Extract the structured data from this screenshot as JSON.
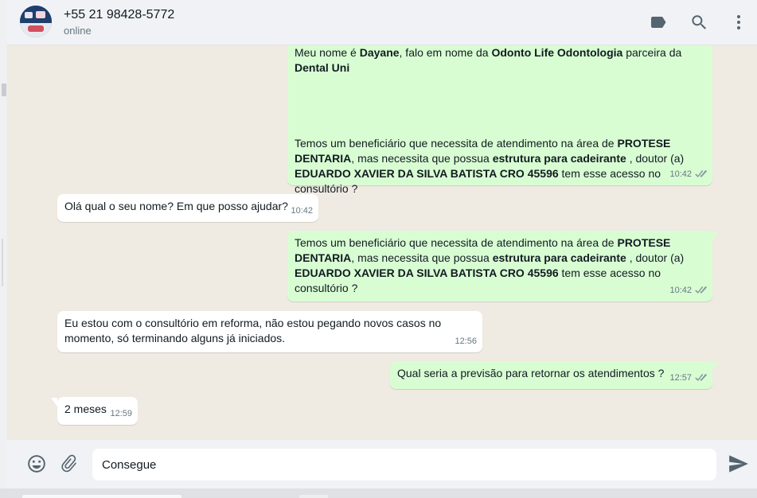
{
  "header": {
    "contact_name": "+55 21 98428-5772",
    "contact_status": "online",
    "icons": [
      "label-icon",
      "search-icon",
      "menu-dots-icon"
    ]
  },
  "colors": {
    "outgoing_bubble": "#d9fdd3",
    "incoming_bubble": "#ffffff",
    "chat_background": "#efeae2",
    "header_background": "#f0f2f5",
    "icon_gray": "#54656f"
  },
  "messages": [
    {
      "direction": "out",
      "parts": [
        {
          "t": "Meu nome é "
        },
        {
          "t": "Dayane",
          "b": true
        },
        {
          "t": ", falo em nome da "
        },
        {
          "t": "Odonto Life Odontologia",
          "b": true
        },
        {
          "t": " parceira da "
        },
        {
          "t": "Dental Uni",
          "b": true
        },
        {
          "br": 5
        },
        {
          "t": "Temos um beneficiário que necessita de atendimento na área de "
        },
        {
          "t": "PROTESE DENTARIA",
          "b": true
        },
        {
          "t": ", mas necessita  que possua "
        },
        {
          "t": "estrutura para cadeirante",
          "b": true
        },
        {
          "t": " , doutor (a) "
        },
        {
          "t": "EDUARDO XAVIER DA SILVA BATISTA  CRO 45596",
          "b": true
        },
        {
          "t": " tem esse acesso no consultório ?"
        }
      ],
      "time": "10:42",
      "ticks": true
    },
    {
      "direction": "in",
      "parts": [
        {
          "t": "Olá qual o seu nome? Em que posso ajudar?"
        }
      ],
      "time": "10:42",
      "ticks": false
    },
    {
      "direction": "out",
      "parts": [
        {
          "t": "Temos um beneficiário que necessita de atendimento na área de "
        },
        {
          "t": "PROTESE DENTARIA",
          "b": true
        },
        {
          "t": ", mas necessita  que possua "
        },
        {
          "t": "estrutura para cadeirante",
          "b": true
        },
        {
          "t": " , doutor (a) "
        },
        {
          "t": "EDUARDO XAVIER DA SILVA BATISTA  CRO 45596",
          "b": true
        },
        {
          "t": " tem esse acesso no consultório ?"
        }
      ],
      "time": "10:42",
      "ticks": true
    },
    {
      "direction": "in",
      "parts": [
        {
          "t": "Eu estou com o consultório em reforma, não estou pegando novos casos no momento, só terminando alguns já iniciados."
        }
      ],
      "time": "12:56",
      "ticks": false
    },
    {
      "direction": "out",
      "parts": [
        {
          "t": "Qual seria a previsão para retornar os atendimentos ?"
        }
      ],
      "time": "12:57",
      "ticks": true
    },
    {
      "direction": "in",
      "parts": [
        {
          "t": "2 meses"
        }
      ],
      "time": "12:59",
      "ticks": false
    }
  ],
  "composer": {
    "value": "Consegue",
    "icons": [
      "emoji-icon",
      "attach-icon",
      "send-icon"
    ]
  }
}
